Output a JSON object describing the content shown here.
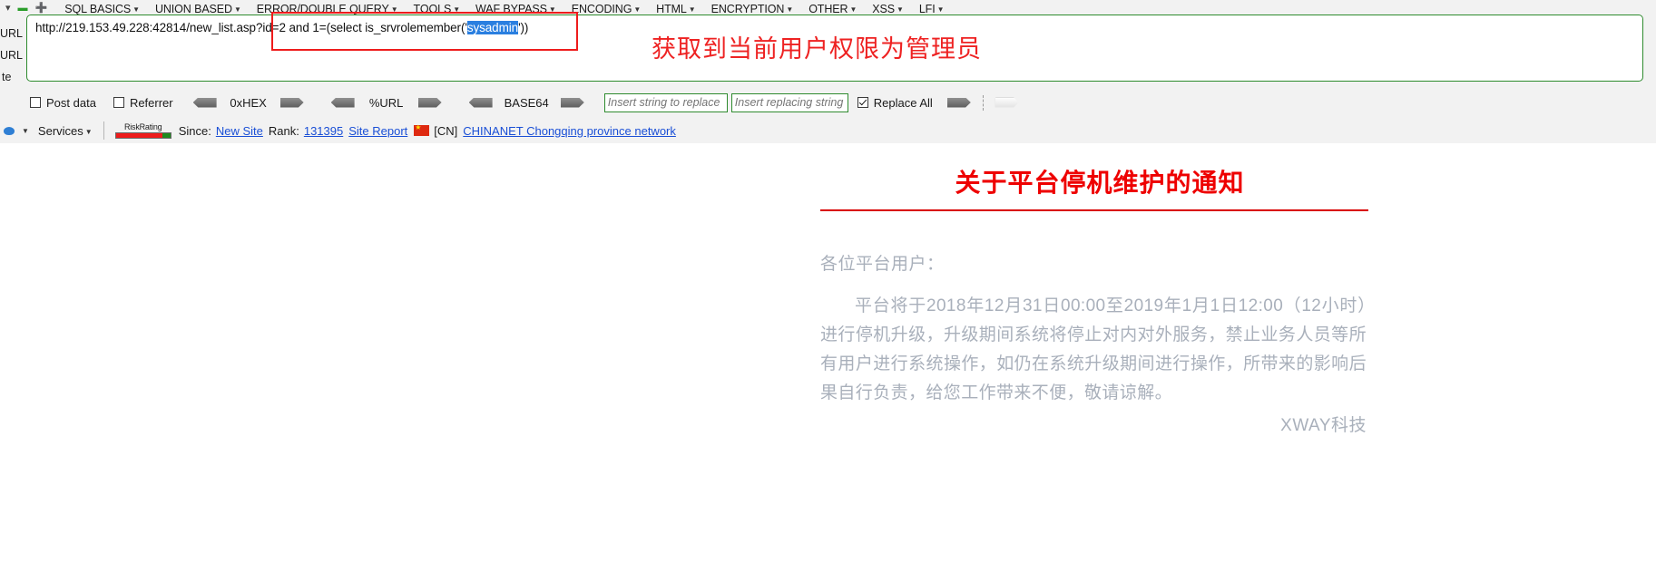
{
  "menubar": {
    "icons": [
      "chevron-down-icon",
      "minus-icon",
      "plus-icon"
    ],
    "items": [
      {
        "label": "SQL BASICS",
        "caret": "▾"
      },
      {
        "label": "UNION BASED",
        "caret": "▾"
      },
      {
        "label": "ERROR/DOUBLE QUERY",
        "caret": "▾"
      },
      {
        "label": "TOOLS",
        "caret": "▾"
      },
      {
        "label": "WAF BYPASS",
        "caret": "▾"
      },
      {
        "label": "ENCODING",
        "caret": "▾"
      },
      {
        "label": "HTML",
        "caret": "▾"
      },
      {
        "label": "ENCRYPTION",
        "caret": "▾"
      },
      {
        "label": "OTHER",
        "caret": "▾"
      },
      {
        "label": "XSS",
        "caret": "▾"
      },
      {
        "label": "LFI",
        "caret": "▾"
      }
    ]
  },
  "side_buttons": [
    {
      "label": "URL"
    },
    {
      "label": "URL"
    },
    {
      "label": "te"
    }
  ],
  "url_bar": {
    "prefix": "http://219.153.49.228:42814/new_list.asp?id=2 and 1=(select is_srvrolemember('",
    "selected": "sysadmin",
    "suffix": "'))"
  },
  "annotation": {
    "text": "获取到当前用户权限为管理员",
    "color": "#ee2222"
  },
  "options": {
    "post_data": "Post data",
    "referrer": "Referrer",
    "encoders": [
      "0xHEX",
      "%URL",
      "BASE64"
    ],
    "replace_search_placeholder": "Insert string to replace",
    "replace_with_placeholder": "Insert replacing string",
    "replace_all": "Replace All"
  },
  "statusbar": {
    "services": "Services",
    "risk_rating": "RiskRating",
    "since_label": "Since:",
    "since_value": "New Site",
    "rank_label": "Rank:",
    "rank_value": "131395",
    "site_report": "Site Report",
    "country_code": "[CN]",
    "isp": "CHINANET Chongqing province network"
  },
  "page": {
    "title": "关于平台停机维护的通知",
    "salutation": "各位平台用户：",
    "body": "平台将于2018年12月31日00:00至2019年1月1日12:00（12小时）进行停机升级，升级期间系统将停止对内对外服务，禁止业务人员等所有用户进行系统操作，如仍在系统升级期间进行操作，所带来的影响后果自行负责，给您工作带来不便，敬请谅解。",
    "signature": "XWAY科技",
    "title_color": "#ee0000",
    "body_color": "#a9b0bb"
  }
}
